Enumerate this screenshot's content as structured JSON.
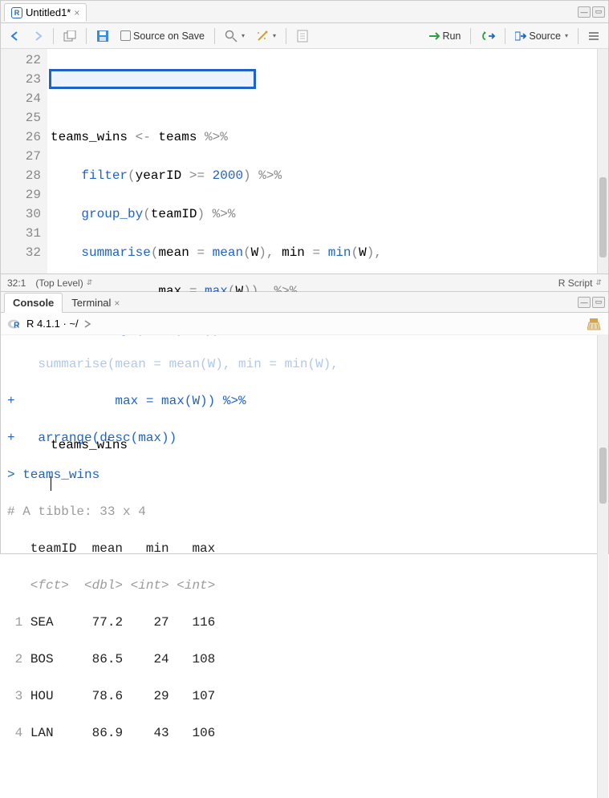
{
  "source": {
    "tab_title": "Untitled1*",
    "source_on_save_label": "Source on Save",
    "run_label": "Run",
    "source_label": "Source",
    "lines": {
      "l22": {
        "num": "22",
        "text": ""
      },
      "l23": {
        "num": "23",
        "ident": "teams_wins",
        "assign": " <- ",
        "rhs": "teams",
        "pipe": " %>%"
      },
      "l24": {
        "num": "24",
        "indent": "    ",
        "fn": "filter",
        "open": "(",
        "arg1": "yearID",
        "op": " >= ",
        "val": "2000",
        "close": ")",
        "pipe": " %>%"
      },
      "l25": {
        "num": "25",
        "indent": "    ",
        "fn": "group_by",
        "open": "(",
        "arg": "teamID",
        "close": ")",
        "pipe": " %>%"
      },
      "l26": {
        "num": "26",
        "indent": "    ",
        "fn": "summarise",
        "open": "(",
        "a1n": "mean",
        "eq1": " = ",
        "a1f": "mean",
        "po1": "(",
        "a1v": "W",
        "pc1": "), ",
        "a2n": "min",
        "eq2": " = ",
        "a2f": "min",
        "po2": "(",
        "a2v": "W",
        "pc2": "),"
      },
      "l27": {
        "num": "27",
        "indent": "              ",
        "a3n": "max",
        "eq3": " = ",
        "a3f": "max",
        "po3": "(",
        "a3v": "W",
        "pc3": "))",
        "pipe": "  %>%"
      },
      "l28": {
        "num": "28",
        "indent": "    ",
        "fn": "arrange",
        "open": "(",
        "fn2": "desc",
        "open2": "(",
        "arg": "max",
        "close": "))"
      },
      "l29": {
        "num": "29"
      },
      "l30": {
        "num": "30"
      },
      "l31": {
        "num": "31",
        "text": "teams_wins"
      },
      "l32": {
        "num": "32"
      }
    },
    "status_pos": "32:1",
    "status_scope": "(Top Level)",
    "status_lang": "R Script"
  },
  "console": {
    "tab_console": "Console",
    "tab_terminal": "Terminal",
    "header": "R 4.1.1 · ~/",
    "out": {
      "cont1": "+             max = max(W)) %>%",
      "cont2": "+   arrange(desc(max))",
      "prompt": "> ",
      "call": "teams_wins",
      "tibble": "# A tibble: 33 x 4",
      "hdr": "   teamID  mean   min   max",
      "types": "   <fct>  <dbl> <int> <int>",
      "rows": [
        {
          "n": " 1",
          "team": "SEA",
          "mean": "77.2",
          "min": "27",
          "max": "116"
        },
        {
          "n": " 2",
          "team": "BOS",
          "mean": "86.5",
          "min": "24",
          "max": "108"
        },
        {
          "n": " 3",
          "team": "HOU",
          "mean": "78.6",
          "min": "29",
          "max": "107"
        },
        {
          "n": " 4",
          "team": "LAN",
          "mean": "86.9",
          "min": "43",
          "max": "106"
        }
      ]
    }
  }
}
